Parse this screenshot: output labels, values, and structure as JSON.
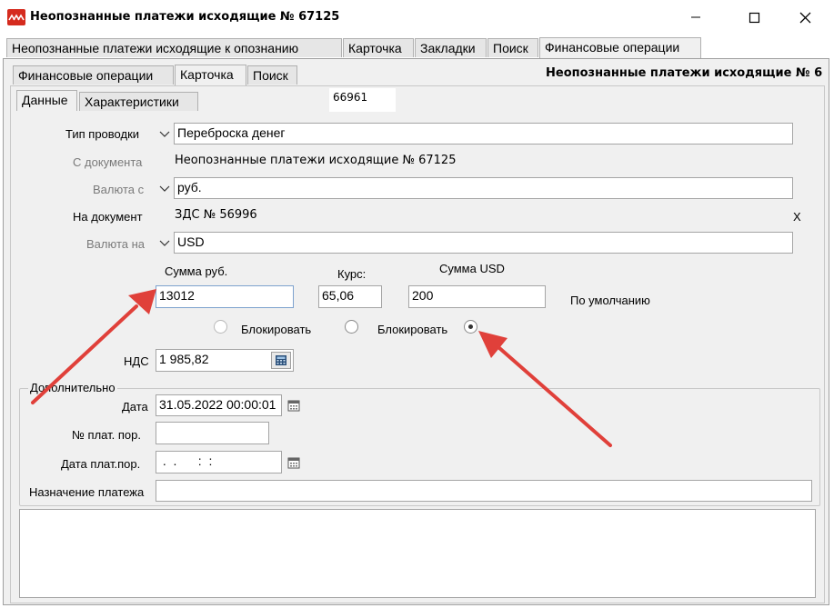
{
  "window": {
    "title": "Неопознанные платежи исходящие № 67125"
  },
  "outer_tabs": [
    {
      "label": "Неопознанные платежи исходящие к опознанию",
      "active": false
    },
    {
      "label": "Карточка",
      "active": false
    },
    {
      "label": "Закладки",
      "active": false
    },
    {
      "label": "Поиск",
      "active": false
    },
    {
      "label": "Финансовые операции",
      "active": true
    }
  ],
  "inner_tabs": [
    {
      "label": "Финансовые операции",
      "active": false
    },
    {
      "label": "Карточка",
      "active": true
    },
    {
      "label": "Поиск",
      "active": false
    }
  ],
  "inner_header": "Неопознанные платежи исходящие № 6",
  "sub_tabs": [
    {
      "label": "Данные",
      "active": true
    },
    {
      "label": "Характеристики",
      "active": false
    }
  ],
  "record_id": "66961",
  "form": {
    "posting_type_label": "Тип проводки",
    "posting_type_value": "Переброска денег",
    "from_document_label": "С документа",
    "from_document_value": "Неопознанные платежи исходящие № 67125",
    "currency_from_label": "Валюта с",
    "currency_from_value": "руб.",
    "to_document_label": "На документ",
    "to_document_value": "ЗДС № 56996",
    "to_document_clear": "X",
    "currency_to_label": "Валюта на",
    "currency_to_value": "USD",
    "sum_rub_label": "Сумма руб.",
    "sum_rub_value": "13012",
    "rate_label": "Курс:",
    "rate_value": "65,06",
    "sum_usd_label": "Сумма USD",
    "sum_usd_value": "200",
    "default_label": "По умолчанию",
    "block_label_1": "Блокировать",
    "block_label_2": "Блокировать",
    "selected_radio": 3,
    "vat_label": "НДС",
    "vat_value": "1 985,82"
  },
  "additional": {
    "legend": "Дополнительно",
    "date_label": "Дата",
    "date_value": "31.05.2022 00:00:01",
    "payment_order_no_label": "№ плат. пор.",
    "payment_order_no_value": "",
    "payment_order_date_label": "Дата плат.пор.",
    "payment_order_date_value": " .  .      :  :",
    "purpose_label": "Назначение платежа",
    "purpose_value": ""
  },
  "colors": {
    "annotation_arrow": "#e0403a",
    "app_icon": "#d52b1e",
    "panel_bg": "#f0f0f0",
    "focus_border": "#7da2ce"
  },
  "icons": {
    "app": "app-logo-icon",
    "minimize": "minimize-icon",
    "maximize": "maximize-icon",
    "close": "close-icon",
    "dropdown": "chevron-down-icon",
    "calculator": "calculator-icon",
    "calendar": "calendar-icon"
  }
}
